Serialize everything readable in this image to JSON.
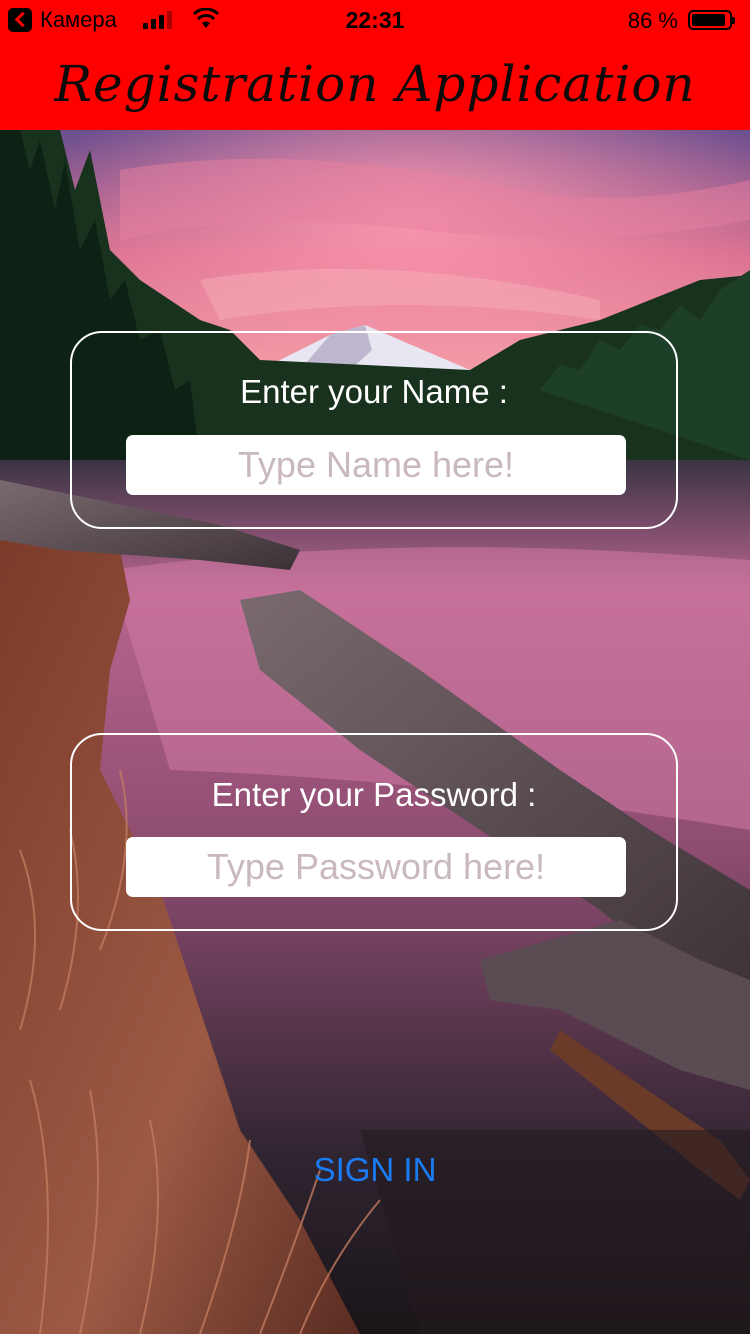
{
  "status_bar": {
    "back_app": "Камера",
    "time": "22:31",
    "battery_percent": "86 %",
    "battery_level": 0.86,
    "signal_icon": "cellular-signal-icon",
    "wifi_icon": "wifi-icon",
    "battery_icon": "battery-icon"
  },
  "header": {
    "title": "Registration Application",
    "background_color": "#ff0000"
  },
  "form": {
    "name_label": "Enter your Name :",
    "name_placeholder": "Type Name here!",
    "password_label": "Enter your Password :",
    "password_placeholder": "Type Password here!",
    "sign_in_label": "SIGN IN",
    "sign_in_color": "#1a7cf4"
  }
}
